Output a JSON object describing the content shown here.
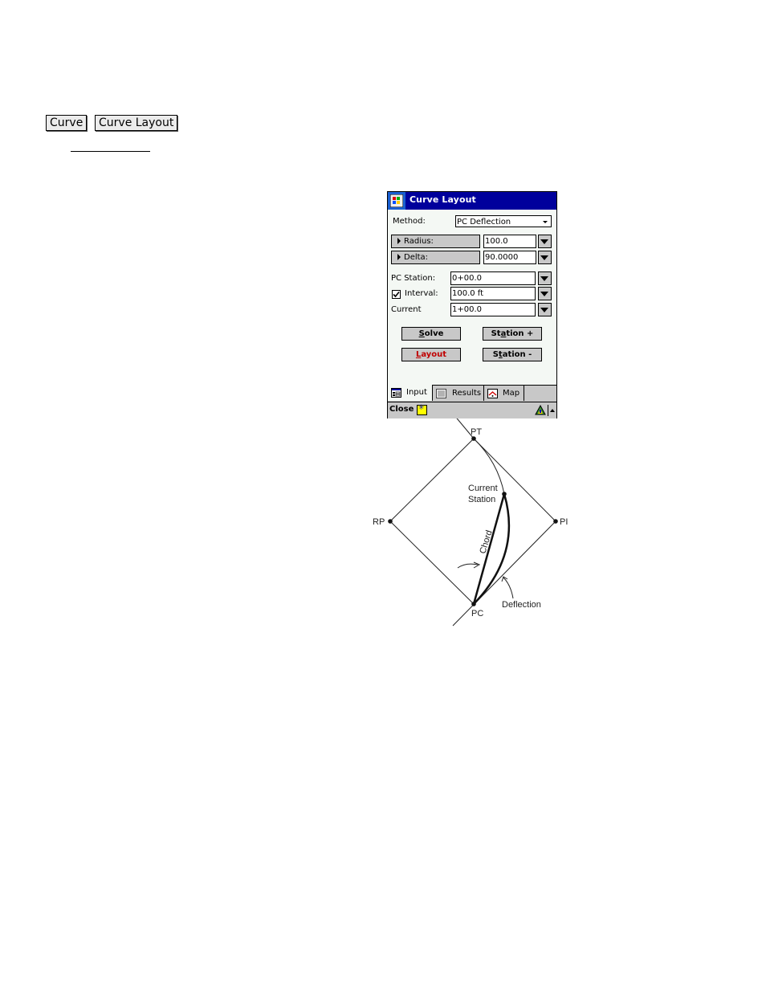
{
  "breadcrumb": {
    "items": [
      "Curve",
      "Curve Layout"
    ]
  },
  "window": {
    "title": "Curve Layout",
    "method_label": "Method:",
    "method_value": "PC Deflection",
    "radius_label": "Radius:",
    "radius_value": "100.0",
    "delta_label": "Delta:",
    "delta_value": "90.0000",
    "pc_station_label": "PC Station:",
    "pc_station_value": "0+00.0",
    "interval_label": "Interval:",
    "interval_value": "100.0 ft",
    "interval_checked": true,
    "current_label": "Current",
    "current_value": "1+00.0",
    "buttons": {
      "solve": {
        "ul": "S",
        "rest": "olve"
      },
      "station_plus": {
        "pre": "St",
        "ul": "a",
        "rest": "tion +"
      },
      "layout": {
        "ul": "L",
        "rest": "ayout"
      },
      "station_minus": {
        "pre": "S",
        "ul": "t",
        "rest": "ation -"
      }
    },
    "tabs": [
      {
        "label": "Input",
        "icon": "input-form-icon",
        "active": true
      },
      {
        "label": "Results",
        "icon": "results-sheet-icon",
        "active": false
      },
      {
        "label": "Map",
        "icon": "map-icon",
        "active": false
      }
    ],
    "command_bar": {
      "close_label": "Close",
      "sip_icon": "keyboard-sip-icon"
    },
    "colors": {
      "titlebar": "#00009c",
      "layout_text": "#c00000",
      "button_gray": "#c8c8c8"
    }
  },
  "diagram": {
    "labels": {
      "pt": "PT",
      "pi": "PI",
      "rp": "RP",
      "pc": "PC",
      "current_station_1": "Current",
      "current_station_2": "Station",
      "chord": "Chord",
      "deflection": "Deflection"
    }
  }
}
